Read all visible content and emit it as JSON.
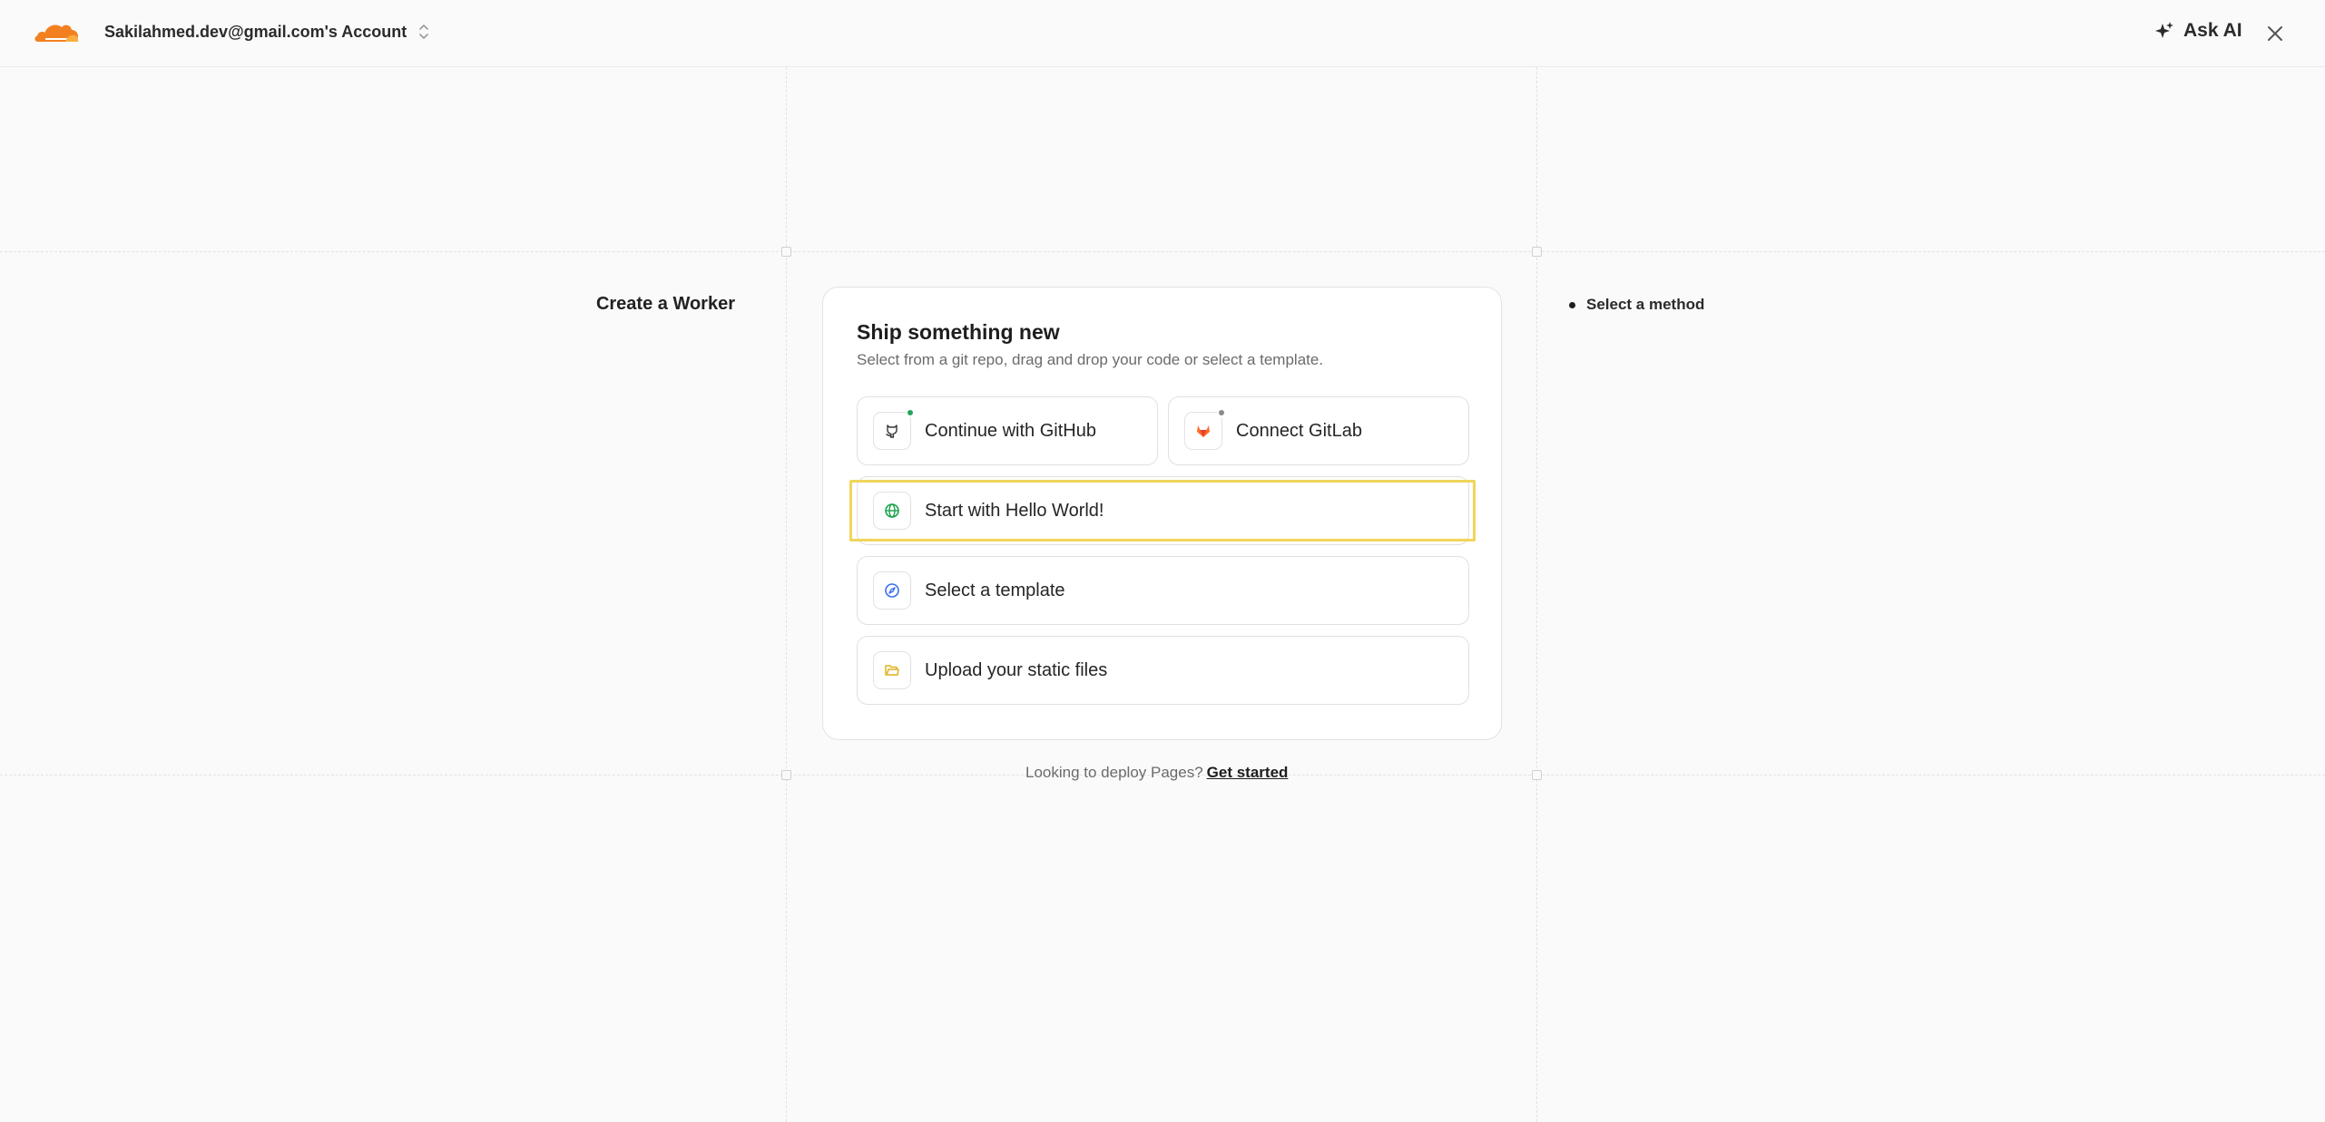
{
  "header": {
    "account_name": "Sakilahmed.dev@gmail.com's Account",
    "ask_ai_label": "Ask AI",
    "brand_color": "#f38020"
  },
  "page": {
    "left_heading": "Create a Worker"
  },
  "card": {
    "title": "Ship something new",
    "subtitle": "Select from a git repo, drag and drop your code or select a template.",
    "options": [
      {
        "label": "Continue with GitHub",
        "icon": "github-icon",
        "status_color": "#22a559"
      },
      {
        "label": "Connect GitLab",
        "icon": "gitlab-icon",
        "status_color": "#8a8a8a"
      },
      {
        "label": "Start with Hello World!",
        "icon": "globe-icon",
        "highlighted": true
      },
      {
        "label": "Select a template",
        "icon": "compass-icon"
      },
      {
        "label": "Upload your static files",
        "icon": "folder-icon"
      }
    ]
  },
  "footer": {
    "prompt": "Looking to deploy Pages?",
    "link_label": "Get started"
  },
  "steps": [
    {
      "label": "Select a method",
      "active": true
    }
  ]
}
